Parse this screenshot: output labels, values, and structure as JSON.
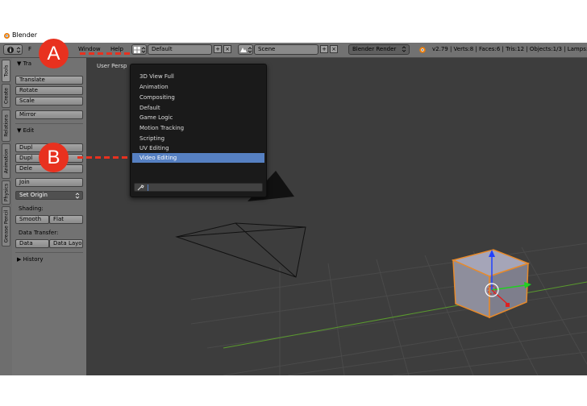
{
  "titlebar": {
    "title": "Blender"
  },
  "header": {
    "menus": [
      "F",
      "Window",
      "Help"
    ],
    "layout_field": "Default",
    "scene_field": "Scene",
    "engine_field": "Blender Render",
    "stats": "v2.79 | Verts:8 | Faces:6 | Tris:12 | Objects:1/3 | Lamps:0"
  },
  "vertical_tabs": [
    "Tools",
    "Create",
    "Relations",
    "Animation",
    "Physics",
    "Grease Pencil"
  ],
  "toolshelf": {
    "transform_header": "Tra",
    "transform_buttons": [
      "Translate",
      "Rotate",
      "Scale"
    ],
    "mirror": "Mirror",
    "edit_header": "Edit",
    "edit_buttons": [
      "Dupl",
      "Dupl",
      "Dele"
    ],
    "join": "Join",
    "set_origin": "Set Origin",
    "shading_label": "Shading:",
    "smooth": "Smooth",
    "flat": "Flat",
    "data_transfer_label": "Data Transfer:",
    "data": "Data",
    "data_layout": "Data Layo",
    "history": "History"
  },
  "viewport": {
    "label": "User Persp"
  },
  "dropdown": {
    "items": [
      "3D View Full",
      "Animation",
      "Compositing",
      "Default",
      "Game Logic",
      "Motion Tracking",
      "Scripting",
      "UV Editing",
      "Video Editing"
    ],
    "selected": "Video Editing"
  },
  "callouts": {
    "a": "A",
    "b": "B"
  },
  "colors": {
    "callout": "#e8311f",
    "selection": "#5680c2",
    "object_outline": "#e88a2a"
  }
}
